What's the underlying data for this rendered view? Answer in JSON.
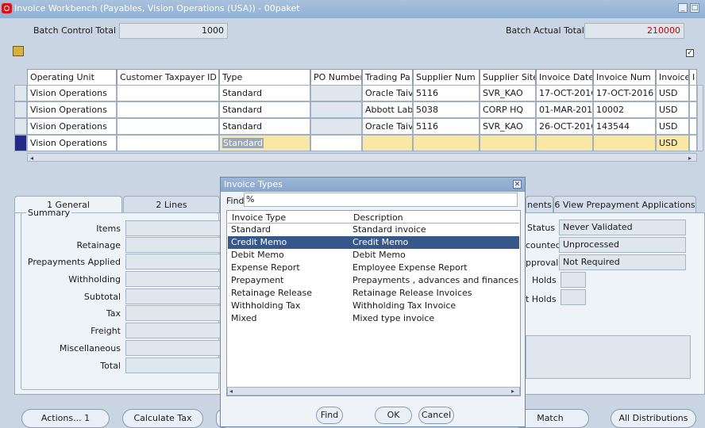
{
  "window": {
    "title": "Invoice Workbench (Payables, Vision Operations (USA)) - 00paket"
  },
  "header": {
    "batch_control_total_label": "Batch Control Total",
    "batch_control_total_value": "1000",
    "batch_actual_total_label": "Batch Actual Total",
    "batch_actual_total_value": "210000"
  },
  "grid": {
    "columns": [
      "Operating Unit",
      "Customer Taxpayer ID",
      "Type",
      "PO Number",
      "Trading Pa",
      "Supplier Num",
      "Supplier Site",
      "Invoice Date",
      "Invoice Num",
      "Invoice",
      "I"
    ],
    "rows": [
      {
        "ou": "Vision Operations",
        "tax": "",
        "type": "Standard",
        "po": "",
        "trading": "Oracle Taiv",
        "supnum": "5116",
        "site": "SVR_KAO",
        "date": "17-OCT-2016",
        "num": "17-OCT-2016",
        "cur": "USD"
      },
      {
        "ou": "Vision Operations",
        "tax": "",
        "type": "Standard",
        "po": "",
        "trading": "Abbott Lab",
        "supnum": "5038",
        "site": "CORP HQ",
        "date": "01-MAR-201",
        "num": "10002",
        "cur": "USD"
      },
      {
        "ou": "Vision Operations",
        "tax": "",
        "type": "Standard",
        "po": "",
        "trading": "Oracle Taiv",
        "supnum": "5116",
        "site": "SVR_KAO",
        "date": "26-OCT-2016",
        "num": "143544",
        "cur": "USD"
      },
      {
        "ou": "Vision Operations",
        "tax": "",
        "type": "Standard",
        "po": "",
        "trading": "",
        "supnum": "",
        "site": "",
        "date": "",
        "num": "",
        "cur": "USD"
      }
    ]
  },
  "tabs": [
    "1 General",
    "2 Lines",
    "nents",
    "6 View Prepayment Applications"
  ],
  "summary": {
    "title": "Summary",
    "labels": [
      "Items",
      "Retainage",
      "Prepayments Applied",
      "Withholding",
      "Subtotal",
      "Tax",
      "Freight",
      "Miscellaneous",
      "Total"
    ]
  },
  "status": {
    "status_label": "Status",
    "status_value": "Never Validated",
    "accounted_label": "counted",
    "accounted_value": "Unprocessed",
    "approval_label": "pproval",
    "approval_value": "Not Required",
    "holds_label": "Holds",
    "release_holds_label": "t Holds"
  },
  "buttons": {
    "actions": "Actions... 1",
    "calculate_tax": "Calculate Tax",
    "match": "Match",
    "all_distributions": "All Distributions"
  },
  "dialog": {
    "title": "Invoice Types",
    "find_label": "Find",
    "find_value": "%",
    "col_type": "Invoice Type",
    "col_desc": "Description",
    "items": [
      {
        "type": "Standard",
        "desc": "Standard invoice"
      },
      {
        "type": "Credit Memo",
        "desc": "Credit Memo"
      },
      {
        "type": "Debit Memo",
        "desc": "Debit Memo"
      },
      {
        "type": "Expense Report",
        "desc": "Employee Expense Report"
      },
      {
        "type": "Prepayment",
        "desc": "Prepayments , advances and finances"
      },
      {
        "type": "Retainage Release",
        "desc": "Retainage Release Invoices"
      },
      {
        "type": "Withholding Tax",
        "desc": "Withholding Tax Invoice"
      },
      {
        "type": "Mixed",
        "desc": "Mixed type invoice"
      }
    ],
    "selected_index": 1,
    "find_button": "Find",
    "ok_button": "OK",
    "cancel_button": "Cancel"
  },
  "colors": {
    "title_bar": "#8fb0d3",
    "selection": "#36578a",
    "red_value": "#cc0000",
    "current_row": "#fbe7a4"
  }
}
